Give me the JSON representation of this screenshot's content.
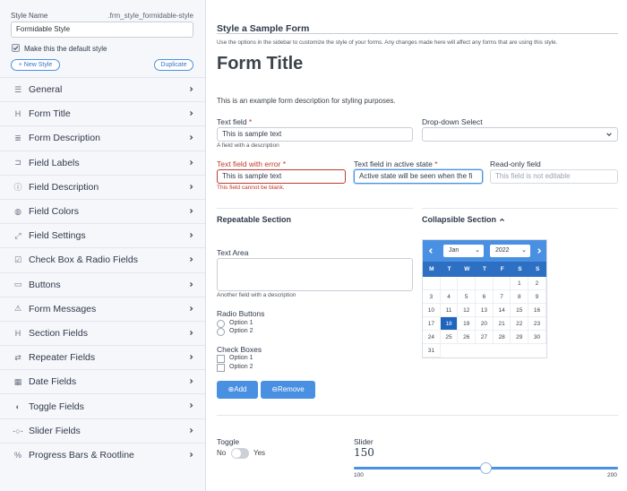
{
  "sidebar": {
    "style_name_label": "Style Name",
    "style_slug": ".frm_style_formidable-style",
    "style_name_value": "Formidable Style",
    "default_label": "Make this the default style",
    "new_style": "New Style",
    "duplicate": "Duplicate",
    "items": [
      {
        "label": "General",
        "icon": "sliders-icon",
        "glyph": "☰"
      },
      {
        "label": "Form Title",
        "icon": "heading-icon",
        "glyph": "H"
      },
      {
        "label": "Form Description",
        "icon": "paragraph-icon",
        "glyph": "≣"
      },
      {
        "label": "Field Labels",
        "icon": "tag-icon",
        "glyph": "⊐"
      },
      {
        "label": "Field Description",
        "icon": "info-icon",
        "glyph": "ⓘ"
      },
      {
        "label": "Field Colors",
        "icon": "palette-icon",
        "glyph": "◍"
      },
      {
        "label": "Field Settings",
        "icon": "expand-icon",
        "glyph": "⤢"
      },
      {
        "label": "Check Box & Radio Fields",
        "icon": "checkbox-icon",
        "glyph": "☑"
      },
      {
        "label": "Buttons",
        "icon": "button-icon",
        "glyph": "▭"
      },
      {
        "label": "Form Messages",
        "icon": "warning-icon",
        "glyph": "⚠"
      },
      {
        "label": "Section Fields",
        "icon": "heading-icon",
        "glyph": "H"
      },
      {
        "label": "Repeater Fields",
        "icon": "repeat-icon",
        "glyph": "⇄"
      },
      {
        "label": "Date Fields",
        "icon": "calendar-icon",
        "glyph": "▦"
      },
      {
        "label": "Toggle Fields",
        "icon": "toggle-icon",
        "glyph": "◐"
      },
      {
        "label": "Slider Fields",
        "icon": "slider-icon",
        "glyph": "-○-"
      },
      {
        "label": "Progress Bars & Rootline",
        "icon": "percent-icon",
        "glyph": "%"
      }
    ]
  },
  "main": {
    "heading": "Style a Sample Form",
    "intro": "Use the options in the sidebar to customize the style of your forms. Any changes made here will affect any forms that are using this style.",
    "form_title": "Form Title",
    "form_desc": "This is an example form description for styling purposes.",
    "text_field": {
      "label": "Text field",
      "value": "This is sample text",
      "desc": "A field with a description"
    },
    "dropdown": {
      "label": "Drop-down Select",
      "value": ""
    },
    "error_field": {
      "label": "Text field with error",
      "value": "This is sample text",
      "error": "This field cannot be blank."
    },
    "active_field": {
      "label": "Text field in active state",
      "value": "Active state will be seen when the fi"
    },
    "readonly_field": {
      "label": "Read-only field",
      "placeholder": "This field is not editable"
    },
    "repeatable": "Repeatable Section",
    "collapsible": "Collapsible Section",
    "textarea": {
      "label": "Text Area",
      "desc": "Another field with a description"
    },
    "radio": {
      "label": "Radio Buttons",
      "options": [
        "Option 1",
        "Option 2"
      ]
    },
    "check": {
      "label": "Check Boxes",
      "options": [
        "Option 1",
        "Option 2"
      ]
    },
    "add": "Add",
    "remove": "Remove",
    "toggle": {
      "label": "Toggle",
      "off": "No",
      "on": "Yes",
      "state": false
    },
    "slider": {
      "label": "Slider",
      "value": "150",
      "min": "100",
      "max": "200",
      "fraction": 0.5
    }
  },
  "calendar": {
    "month": "Jan",
    "year": "2022",
    "weekdays": [
      "M",
      "T",
      "W",
      "T",
      "F",
      "S",
      "S"
    ],
    "leading_blanks": 5,
    "days": 31,
    "selected": 18
  },
  "colors": {
    "accent": "#4a90e2",
    "accent_dark": "#2d6fc2",
    "error": "#c0392b"
  }
}
